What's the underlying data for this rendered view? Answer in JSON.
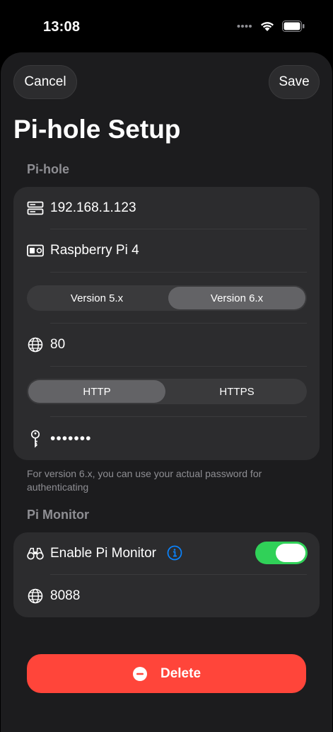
{
  "status": {
    "time": "13:08"
  },
  "nav": {
    "cancel_label": "Cancel",
    "save_label": "Save"
  },
  "title": "Pi-hole Setup",
  "pihole": {
    "section_label": "Pi-hole",
    "address": "192.168.1.123",
    "name": "Raspberry Pi 4",
    "version_options": [
      "Version 5.x",
      "Version 6.x"
    ],
    "version_selected": "Version 6.x",
    "port": "80",
    "protocol_options": [
      "HTTP",
      "HTTPS"
    ],
    "protocol_selected": "HTTP",
    "password_masked": "•••••••",
    "footnote": "For version 6.x, you can use your actual password for authenticating"
  },
  "monitor": {
    "section_label": "Pi Monitor",
    "enable_label": "Enable Pi Monitor",
    "enabled": true,
    "port": "8088"
  },
  "delete_label": "Delete",
  "colors": {
    "toggle_on": "#30d158",
    "delete": "#ff453a",
    "info": "#0a84ff"
  },
  "icons": {
    "address": "server-icon",
    "name": "id-card-icon",
    "port": "globe-icon",
    "password": "key-icon",
    "monitor": "binoculars-icon",
    "info": "info-icon",
    "delete": "minus-circle-icon"
  }
}
